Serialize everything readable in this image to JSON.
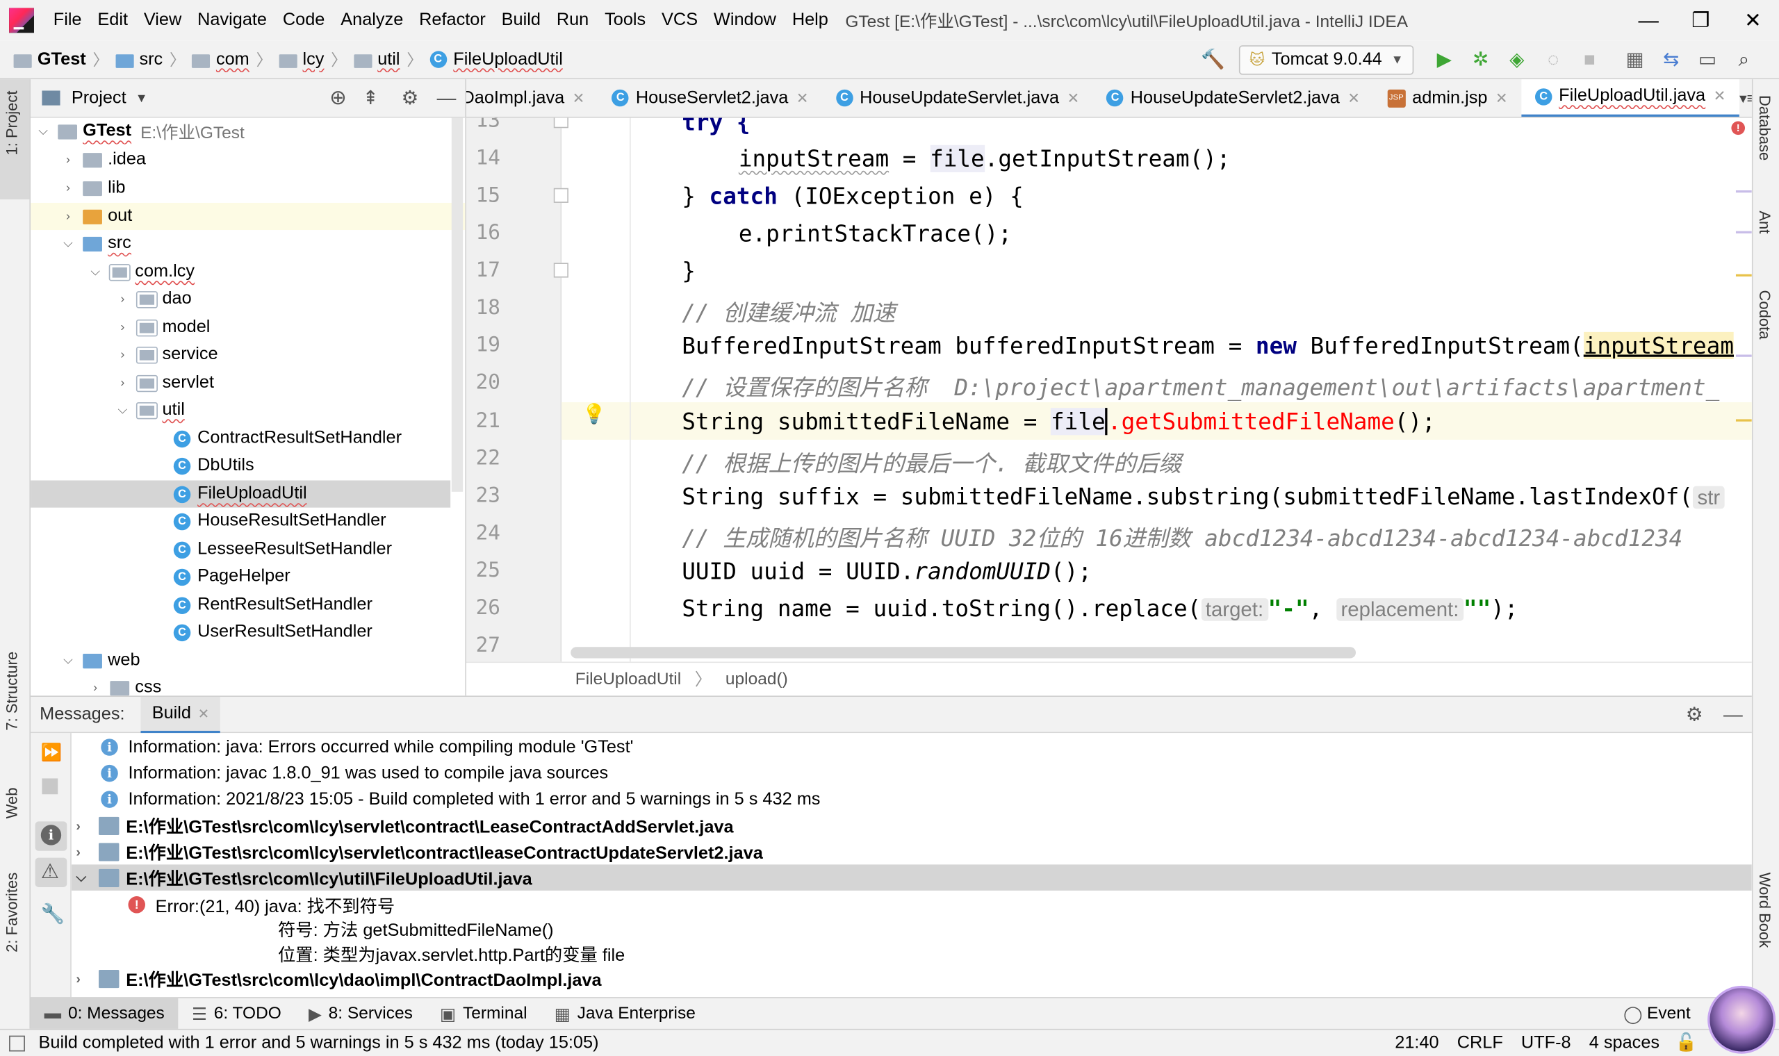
{
  "menubar": {
    "items": [
      "File",
      "Edit",
      "View",
      "Navigate",
      "Code",
      "Analyze",
      "Refactor",
      "Build",
      "Run",
      "Tools",
      "VCS",
      "Window",
      "Help"
    ],
    "title": "GTest [E:\\作业\\GTest] - ...\\src\\com\\lcy\\util\\FileUploadUtil.java - IntelliJ IDEA"
  },
  "navbar": {
    "breadcrumbs": [
      "GTest",
      "src",
      "com",
      "lcy",
      "util",
      "FileUploadUtil"
    ],
    "run_config": "Tomcat 9.0.44"
  },
  "left_tool_windows": [
    "1: Project",
    "7: Structure",
    "Web",
    "2: Favorites"
  ],
  "right_tool_windows": [
    "Database",
    "Ant",
    "Codota",
    "Word Book"
  ],
  "project": {
    "title": "Project",
    "tree": [
      {
        "label": "GTest",
        "path": "E:\\作业\\GTest"
      },
      {
        "label": ".idea"
      },
      {
        "label": "lib"
      },
      {
        "label": "out"
      },
      {
        "label": "src"
      },
      {
        "label": "com.lcy"
      },
      {
        "label": "dao"
      },
      {
        "label": "model"
      },
      {
        "label": "service"
      },
      {
        "label": "servlet"
      },
      {
        "label": "util"
      },
      {
        "label": "ContractResultSetHandler"
      },
      {
        "label": "DbUtils"
      },
      {
        "label": "FileUploadUtil"
      },
      {
        "label": "HouseResultSetHandler"
      },
      {
        "label": "LesseeResultSetHandler"
      },
      {
        "label": "PageHelper"
      },
      {
        "label": "RentResultSetHandler"
      },
      {
        "label": "UserResultSetHandler"
      },
      {
        "label": "web"
      },
      {
        "label": "css"
      }
    ]
  },
  "editor": {
    "tabs": [
      "DaoImpl.java",
      "HouseServlet2.java",
      "HouseUpdateServlet.java",
      "HouseUpdateServlet2.java",
      "admin.jsp",
      "FileUploadUtil.java"
    ],
    "tab_overflow": "1",
    "lines": [
      "13",
      "14",
      "15",
      "16",
      "17",
      "18",
      "19",
      "20",
      "21",
      "22",
      "23",
      "24",
      "25",
      "26",
      "27"
    ],
    "code": {
      "l13_try": "try {",
      "l14_a": "inputStream",
      "l14_b": " = ",
      "l14_c": "file",
      "l14_d": ".getInputStream();",
      "l15_a": "} ",
      "l15_b": "catch",
      "l15_c": " (IOException e) {",
      "l16": "e.printStackTrace();",
      "l17": "}",
      "l18": "// 创建缓冲流 加速",
      "l19_a": "BufferedInputStream bufferedInputStream = ",
      "l19_b": "new",
      "l19_c": " BufferedInputStream(",
      "l19_d": "inputStream",
      "l20": "// 设置保存的图片名称  D:\\project\\apartment_management\\out\\artifacts\\apartment_",
      "l21_a": "String submittedFileName = ",
      "l21_b": "file",
      "l21_c": ".getSubmittedFileName",
      "l21_d": "();",
      "l22": "// 根据上传的图片的最后一个. 截取文件的后缀",
      "l23_a": "String suffix = submittedFileName.substring(submittedFileName.lastIndexOf(",
      "l23_b": "str",
      "l24": "// 生成随机的图片名称 UUID 32位的 16进制数 abcd1234-abcd1234-abcd1234-abcd1234",
      "l25_a": "UUID uuid = UUID.",
      "l25_b": "randomUUID",
      "l25_c": "();",
      "l26_a": "String name = uuid.toString().replace(",
      "l26_h1": "target:",
      "l26_s1": "\"-\"",
      "l26_comma": ", ",
      "l26_h2": "replacement:",
      "l26_s2": "\"\"",
      "l26_end": ");"
    },
    "breadcrumb": [
      "FileUploadUtil",
      "upload()"
    ]
  },
  "messages": {
    "label": "Messages:",
    "tab": "Build",
    "rows": [
      "Information: java: Errors occurred while compiling module 'GTest'",
      "Information: javac 1.8.0_91 was used to compile java sources",
      "Information: 2021/8/23 15:05 - Build completed with 1 error and 5 warnings in 5 s 432 ms",
      "E:\\作业\\GTest\\src\\com\\lcy\\servlet\\contract\\LeaseContractAddServlet.java",
      "E:\\作业\\GTest\\src\\com\\lcy\\servlet\\contract\\leaseContractUpdateServlet2.java",
      "E:\\作业\\GTest\\src\\com\\lcy\\util\\FileUploadUtil.java",
      "Error:(21, 40)  java: 找不到符号",
      "符号:   方法 getSubmittedFileName()",
      "位置: 类型为javax.servlet.http.Part的变量 file",
      "E:\\作业\\GTest\\src\\com\\lcy\\dao\\impl\\ContractDaoImpl.java"
    ]
  },
  "bottom_tabs": [
    "0: Messages",
    "6: TODO",
    "8: Services",
    "Terminal",
    "Java Enterprise"
  ],
  "event_log": "Event",
  "status": {
    "message": "Build completed with 1 error and 5 warnings in 5 s 432 ms (today 15:05)",
    "position": "21:40",
    "line_sep": "CRLF",
    "encoding": "UTF-8",
    "indent": "4 spaces"
  }
}
